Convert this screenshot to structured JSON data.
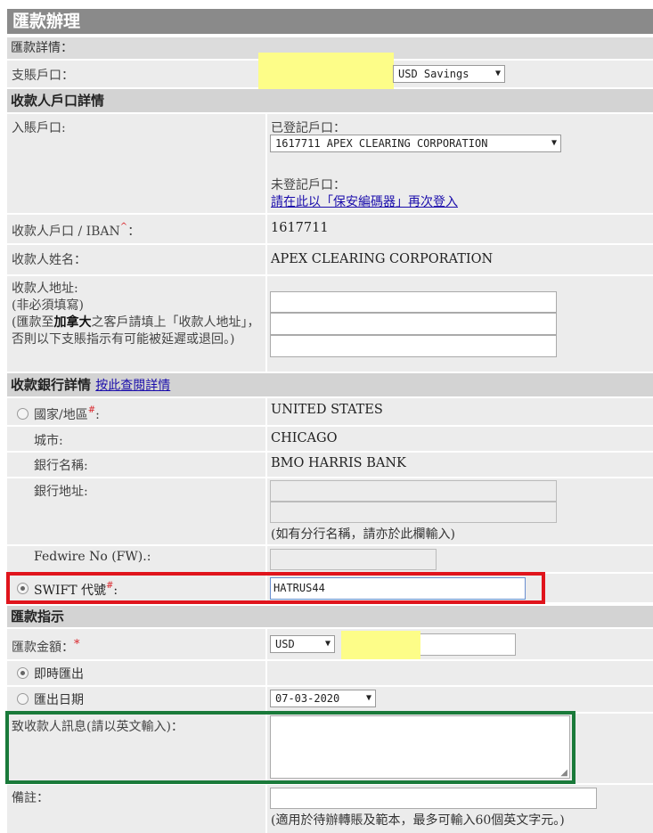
{
  "title": "匯款辦理",
  "remit_details": {
    "heading": "匯款詳情：",
    "debit_label": "支賬戶口：",
    "debit_currency": "USD Savings"
  },
  "payee_account": {
    "heading": "收款人戶口詳情",
    "credit_label": "入賬戶口:",
    "registered_label": "已登記戶口：",
    "registered_value": "1617711 APEX CLEARING CORPORATION",
    "unregistered_label": "未登記戶口：",
    "relogin_link": "請在此以「保安編碼器」再次登入",
    "account_label": "收款人戶口 / IBAN",
    "account_mark": "^",
    "account_colon": "：",
    "account_value": "1617711",
    "name_label": "收款人姓名：",
    "name_value": "APEX CLEARING CORPORATION",
    "address_label": "收款人地址:",
    "address_optional": "(非必須填寫)",
    "address_note_pre": "(匯款至",
    "address_note_bold": "加拿大",
    "address_note_post": "之客戶請填上「收款人地址」，否則以下支賬指示有可能被延遲或退回。)"
  },
  "bank": {
    "heading": "收款銀行詳情",
    "details_link": "按此查閱詳情",
    "country_label": "國家/地區",
    "country_req": "#",
    "country_value": "UNITED STATES",
    "city_label": "城市:",
    "city_value": "CHICAGO",
    "bank_name_label": "銀行名稱:",
    "bank_name_value": "BMO HARRIS BANK",
    "bank_address_label": "銀行地址:",
    "branch_note": "(如有分行名稱，請亦於此欄輸入)",
    "fedwire_label": "Fedwire No (FW).:",
    "swift_label": "SWIFT 代號",
    "swift_req": "#",
    "swift_value": "HATRUS44"
  },
  "instruction": {
    "heading": "匯款指示",
    "amount_label": "匯款金額：",
    "amount_req": "*",
    "currency": "USD",
    "immediate_label": "即時匯出",
    "date_label": "匯出日期",
    "date_value": "07-03-2020",
    "message_label": "致收款人訊息(請以英文輸入)：",
    "remarks_label": "備註：",
    "remarks_note": "(適用於待辦轉賬及範本，最多可輸入60個英文字元。)"
  },
  "colors": {
    "swift_highlight": "#e0141c",
    "message_highlight": "#1a7a3a",
    "redaction": "#fdfd88"
  }
}
